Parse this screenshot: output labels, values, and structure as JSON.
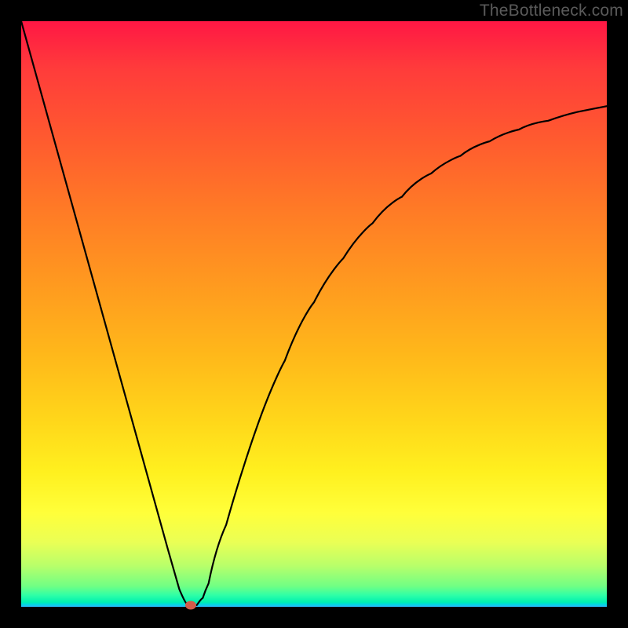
{
  "attribution": "TheBottleneck.com",
  "chart_data": {
    "type": "line",
    "title": "",
    "xlabel": "",
    "ylabel": "",
    "xlim": [
      0,
      100
    ],
    "ylim": [
      0,
      100
    ],
    "grid": false,
    "legend": false,
    "series": [
      {
        "name": "curve",
        "x": [
          0,
          5,
          10,
          15,
          20,
          25,
          27,
          28.5,
          30,
          31,
          32,
          35,
          40,
          45,
          50,
          55,
          60,
          65,
          70,
          75,
          80,
          85,
          90,
          95,
          100
        ],
        "values": [
          100,
          82,
          64,
          46,
          28,
          10,
          3,
          0.3,
          0.3,
          1.5,
          4,
          14,
          30,
          42,
          52,
          59.5,
          65.5,
          70,
          74,
          77,
          79.5,
          81.5,
          83,
          84.5,
          85.5
        ]
      }
    ],
    "marker": {
      "x": 29,
      "y": 0,
      "color": "#d35a4a"
    },
    "background_gradient": {
      "top": "#ff1744",
      "middle": "#ffd61a",
      "bottom": "#00f0b0"
    }
  }
}
